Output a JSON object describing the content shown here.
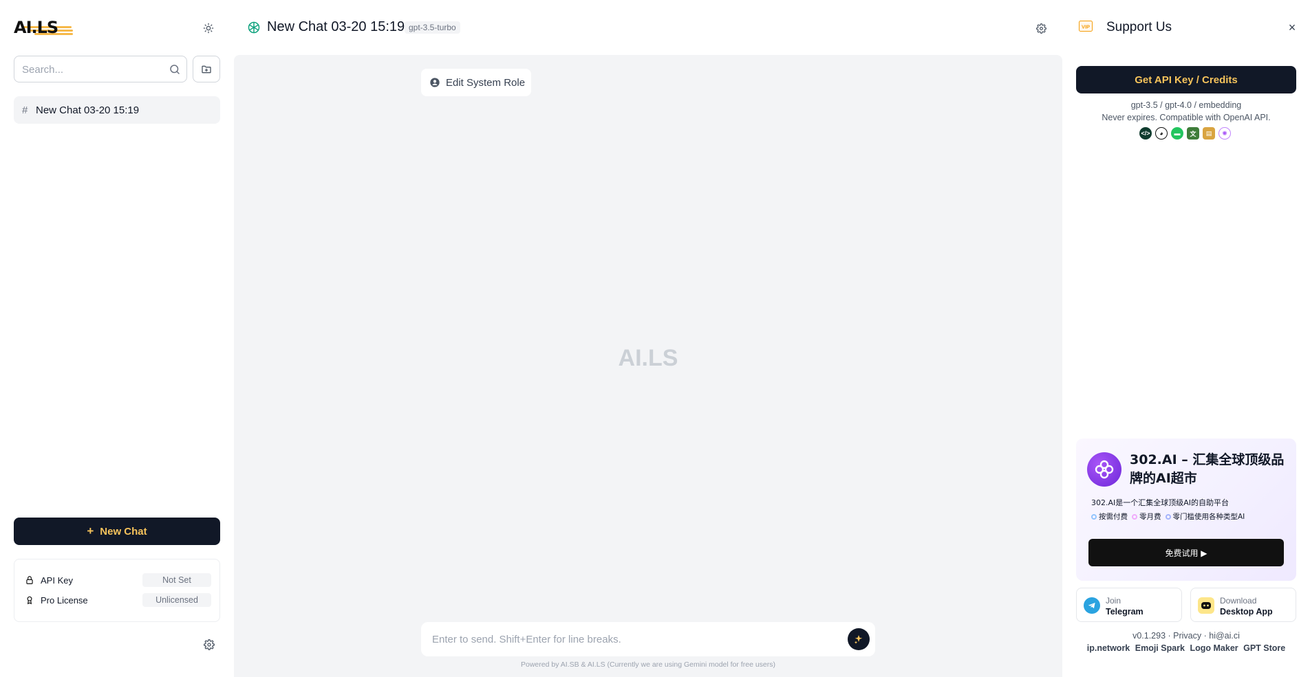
{
  "sidebar": {
    "logo_text": "AI.LS",
    "search_placeholder": "Search...",
    "chats": [
      {
        "label": "New Chat 03-20 15:19"
      }
    ],
    "new_chat_label": "New Chat",
    "settings": {
      "api_key_label": "API Key",
      "api_key_value": "Not Set",
      "pro_license_label": "Pro License",
      "pro_license_value": "Unlicensed"
    }
  },
  "header": {
    "title": "New Chat 03-20 15:19",
    "model": "gpt-3.5-turbo"
  },
  "main": {
    "edit_role_label": "Edit System Role",
    "watermark": "AI.LS",
    "input_placeholder": "Enter to send. Shift+Enter for line breaks.",
    "footer_note": "Powered by AI.SB & AI.LS (Currently we are using Gemini model for free users)"
  },
  "right_panel": {
    "vip_label": "VIP",
    "title": "Support Us",
    "api_button_label": "Get API Key / Credits",
    "models_line": "gpt-3.5 / gpt-4.0 / embedding",
    "compat_line": "Never expires. Compatible with OpenAI API.",
    "provider_icons": [
      "code-icon",
      "cat-icon",
      "chat-bubble-icon",
      "translate-icon",
      "book-icon",
      "openai-icon"
    ],
    "ad": {
      "title": "302.AI – 汇集全球顶级品牌的AI超市",
      "desc": "302.AI是一个汇集全球顶级AI的自助平台",
      "features": [
        "按需付费",
        "零月费",
        "零门槛使用各种类型AI"
      ],
      "button_label": "免费试用 ▶"
    },
    "telegram": {
      "top": "Join",
      "bottom": "Telegram"
    },
    "desktop": {
      "top": "Download",
      "bottom": "Desktop App"
    },
    "version": "v0.1.293",
    "privacy": "Privacy",
    "email": "hi@ai.ci",
    "links": [
      "ip.network",
      "Emoji Spark",
      "Logo Maker",
      "GPT Store"
    ]
  },
  "colors": {
    "accent": "#f6c35b",
    "dark": "#111827",
    "main_bg": "#f3f4f6"
  }
}
